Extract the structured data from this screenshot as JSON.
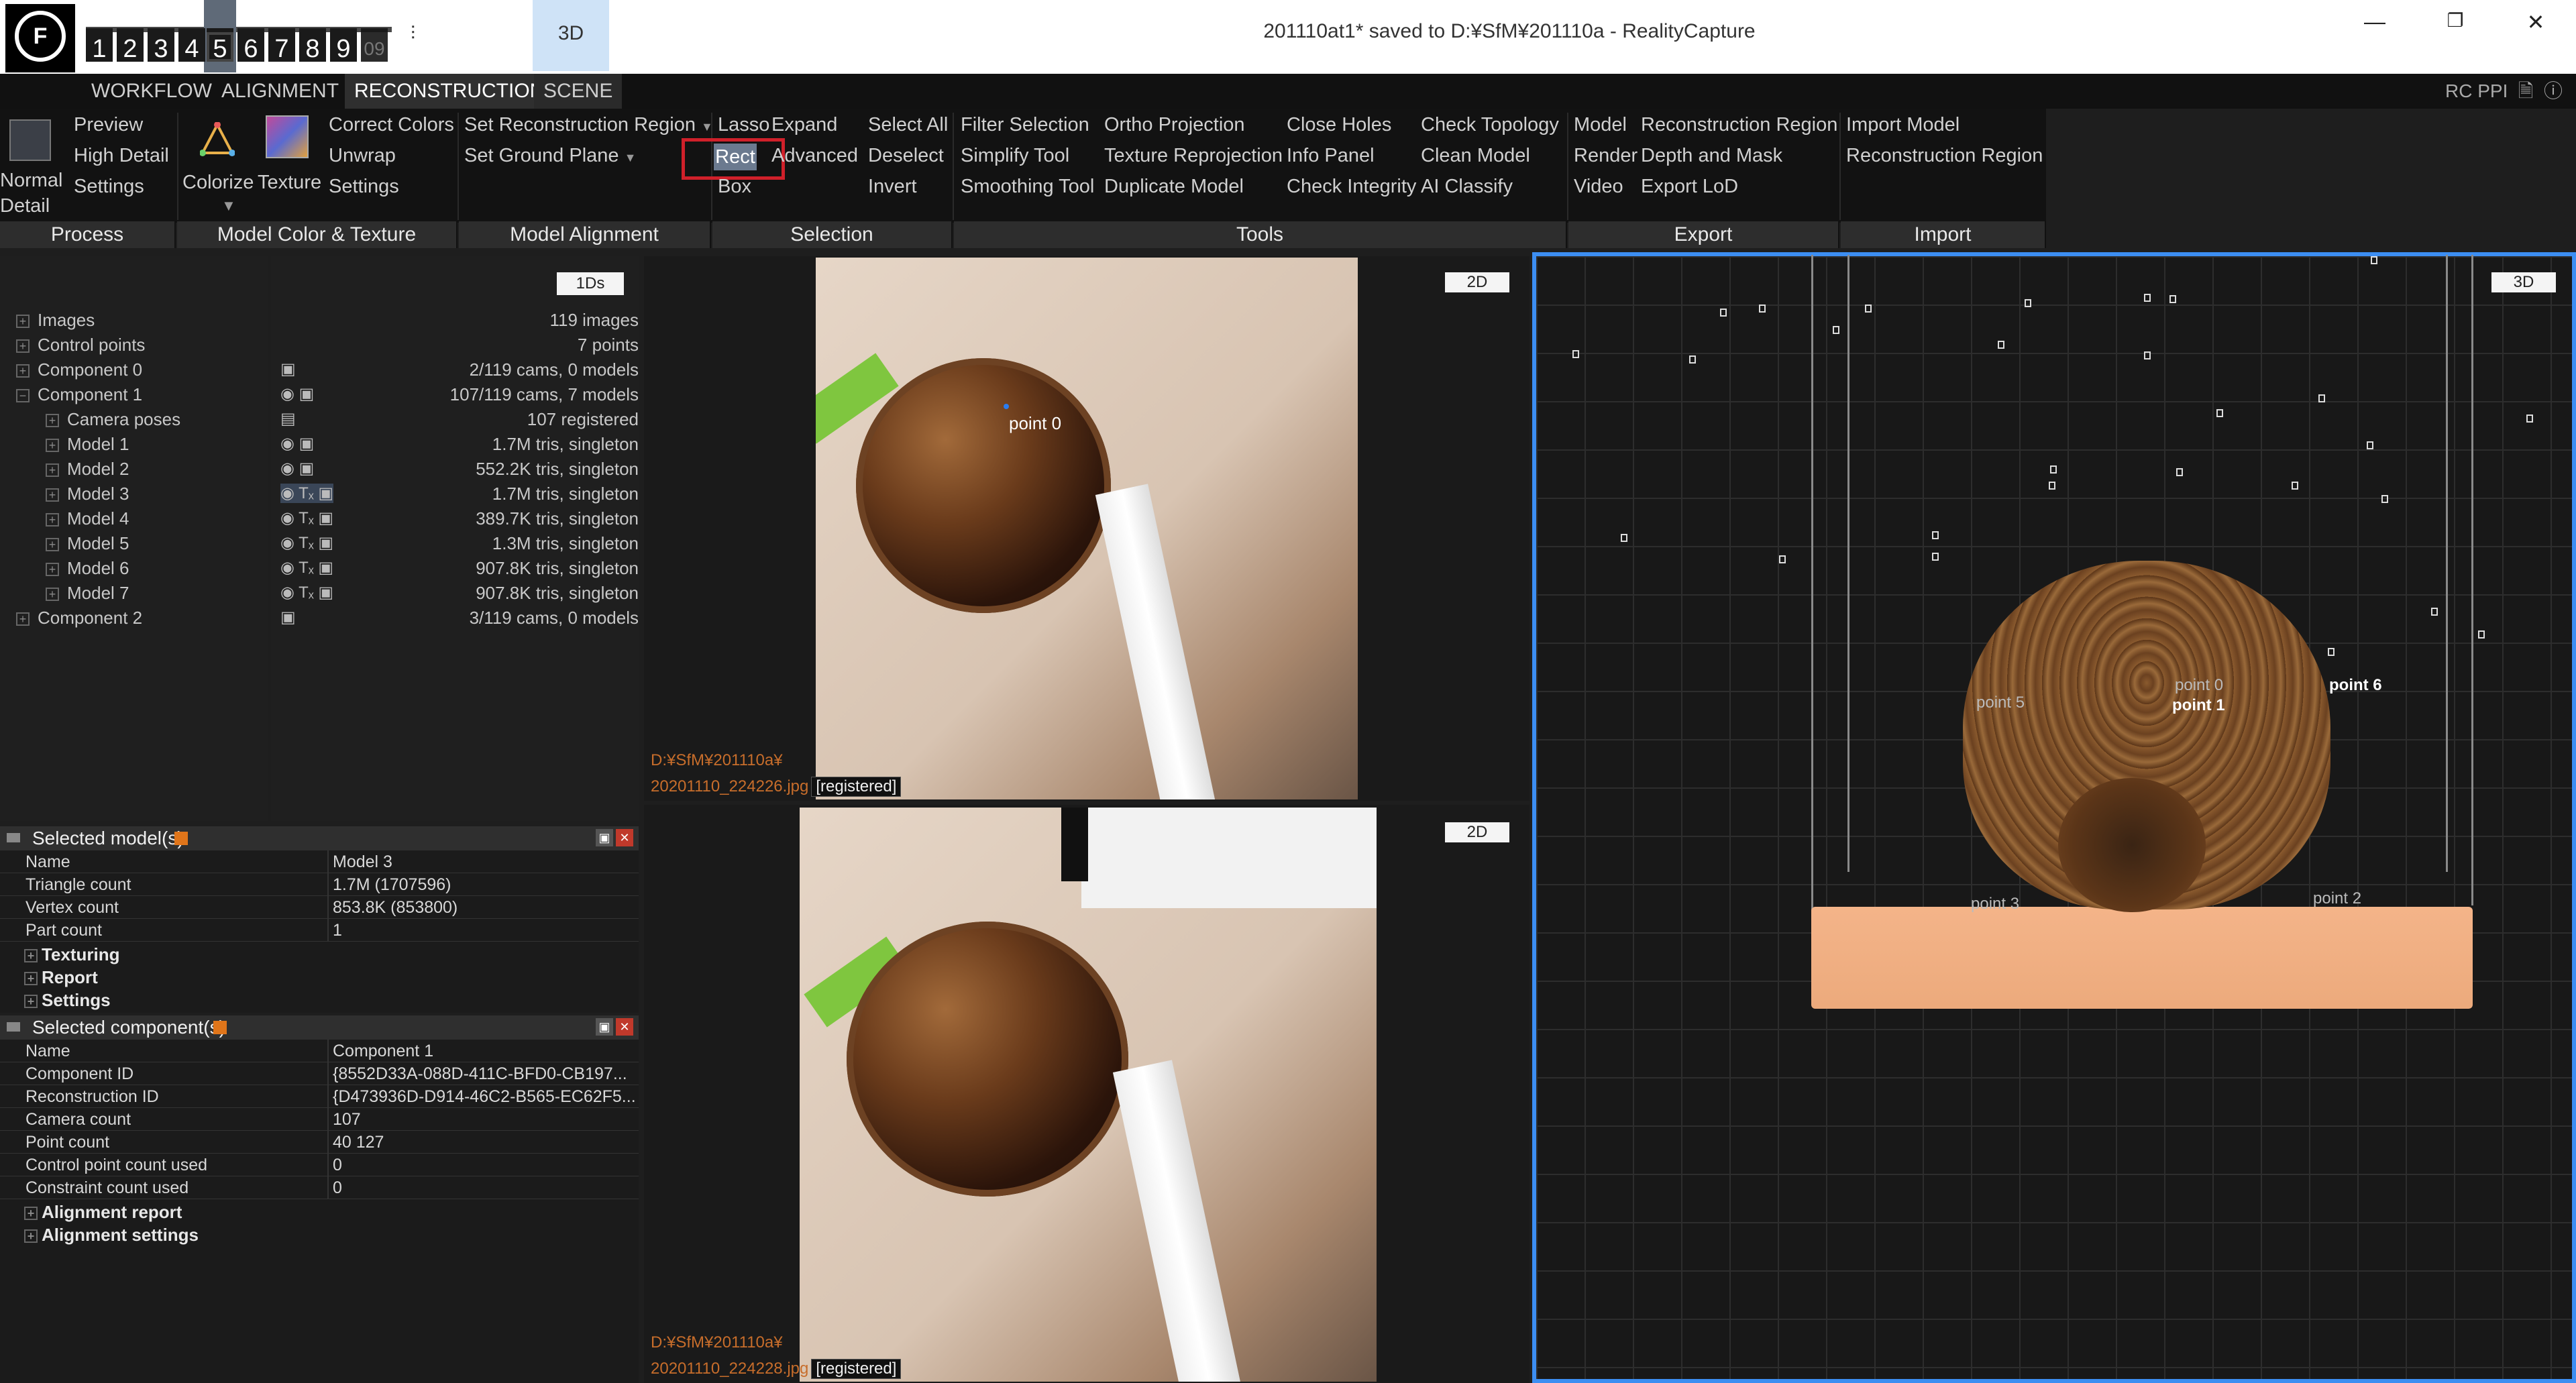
{
  "window": {
    "title": "201110at1* saved to D:¥SfM¥201110a - RealityCapture",
    "view_tab": "3D",
    "min_glyph": "—",
    "max_glyph": "❐",
    "close_glyph": "✕"
  },
  "layouts": [
    "1",
    "2",
    "3",
    "4",
    "5",
    "6",
    "7",
    "8",
    "9",
    "09"
  ],
  "menu": {
    "tabs": [
      "WORKFLOW",
      "ALIGNMENT",
      "RECONSTRUCTION",
      "SCENE"
    ],
    "right_label": "RC PPI"
  },
  "ribbon": {
    "process": {
      "normal_detail": "Normal\nDetail",
      "preview": "Preview",
      "high_detail": "High Detail",
      "settings": "Settings",
      "group": "Process"
    },
    "color_texture": {
      "colorize": "Colorize",
      "texture": "Texture",
      "correct_colors": "Correct Colors",
      "unwrap": "Unwrap",
      "settings": "Settings",
      "group": "Model Color & Texture"
    },
    "alignment": {
      "set_recon_region": "Set Reconstruction Region",
      "set_ground_plane": "Set Ground Plane",
      "group": "Model Alignment"
    },
    "selection": {
      "lasso": "Lasso",
      "expand": "Expand",
      "rect": "Rect",
      "advanced": "Advanced",
      "box": "Box",
      "select_all": "Select All",
      "deselect": "Deselect",
      "invert": "Invert",
      "group": "Selection"
    },
    "tools": {
      "filter_selection": "Filter Selection",
      "simplify_tool": "Simplify Tool",
      "smoothing_tool": "Smoothing Tool",
      "ortho_projection": "Ortho Projection",
      "texture_reprojection": "Texture Reprojection",
      "duplicate_model": "Duplicate Model",
      "close_holes": "Close Holes",
      "info_panel": "Info Panel",
      "check_integrity": "Check Integrity",
      "check_topology": "Check Topology",
      "clean_model": "Clean Model",
      "ai_classify": "AI Classify",
      "group": "Tools"
    },
    "export": {
      "model": "Model",
      "render": "Render",
      "video": "Video",
      "recon_region": "Reconstruction Region",
      "depth_mask": "Depth and Mask",
      "export_lod": "Export LoD",
      "group": "Export"
    },
    "import": {
      "import_model": "Import Model",
      "recon_region": "Reconstruction Region",
      "group": "Import"
    }
  },
  "tree": {
    "badge": "1Ds",
    "rows": [
      {
        "label": "Images",
        "info": "119 images"
      },
      {
        "label": "Control points",
        "info": "7 points"
      },
      {
        "label": "Component 0",
        "info": "2/119 cams, 0 models"
      },
      {
        "label": "Component 1",
        "info": "107/119 cams, 7 models"
      },
      {
        "label": "Camera poses",
        "info": "107 registered"
      },
      {
        "label": "Model 1",
        "info": "1.7M tris, singleton"
      },
      {
        "label": "Model 2",
        "info": "552.2K tris, singleton"
      },
      {
        "label": "Model 3",
        "info": "1.7M tris, singleton"
      },
      {
        "label": "Model 4",
        "info": "389.7K tris, singleton"
      },
      {
        "label": "Model 5",
        "info": "1.3M tris, singleton"
      },
      {
        "label": "Model 6",
        "info": "907.8K tris, singleton"
      },
      {
        "label": "Model 7",
        "info": "907.8K tris, singleton"
      },
      {
        "label": "Component 2",
        "info": "3/119 cams, 0 models"
      }
    ]
  },
  "selected_models": {
    "title": "Selected model(s)",
    "rows": [
      {
        "k": "Name",
        "v": "Model 3"
      },
      {
        "k": "Triangle count",
        "v": "1.7M (1707596)"
      },
      {
        "k": "Vertex count",
        "v": "853.8K (853800)"
      },
      {
        "k": "Part count",
        "v": "1"
      }
    ],
    "sections": [
      "Texturing",
      "Report",
      "Settings"
    ]
  },
  "selected_components": {
    "title": "Selected component(s)",
    "rows": [
      {
        "k": "Name",
        "v": "Component 1"
      },
      {
        "k": "Component ID",
        "v": "{8552D33A-088D-411C-BFD0-CB197..."
      },
      {
        "k": "Reconstruction ID",
        "v": "{D473936D-D914-46C2-B565-EC62F5..."
      },
      {
        "k": "Camera count",
        "v": "107"
      },
      {
        "k": "Point count",
        "v": "40 127"
      },
      {
        "k": "Control point count used",
        "v": "0"
      },
      {
        "k": "Constraint count used",
        "v": "0"
      }
    ],
    "sections": [
      "Alignment report",
      "Alignment settings"
    ]
  },
  "image_views": [
    {
      "tag": "2D",
      "path": "D:¥SfM¥201110a¥",
      "file": "20201110_224226.jpg",
      "status": "[registered]",
      "point": "point 0"
    },
    {
      "tag": "2D",
      "path": "D:¥SfM¥201110a¥",
      "file": "20201110_224228.jpg",
      "status": "[registered]"
    }
  ],
  "view3d": {
    "tag": "3D",
    "labels": [
      "point 0",
      "point 1",
      "point 5",
      "point 6",
      "point 3",
      "point 2"
    ]
  },
  "colors": {
    "accent_blue": "#3c8ef2",
    "highlight_red": "#d0202a",
    "path_orange": "#c76d2b",
    "base_salmon": "#f0a878"
  }
}
